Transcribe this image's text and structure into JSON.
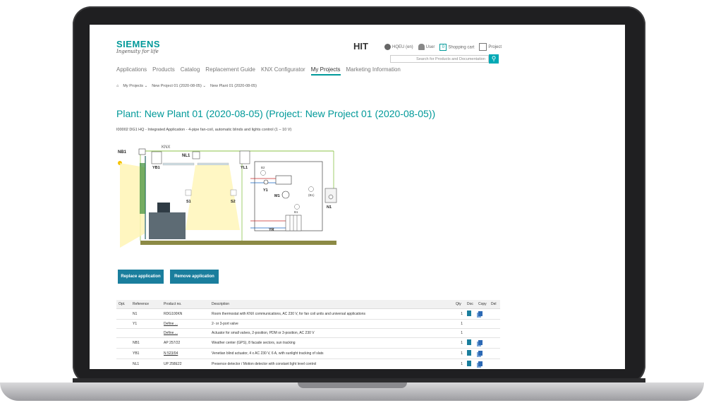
{
  "brand": {
    "name": "SIEMENS",
    "tagline": "Ingenuity for life",
    "app": "HIT"
  },
  "toplinks": {
    "region": "HQEU (en)",
    "user": "User",
    "cart_count": "0",
    "cart": "Shopping cart",
    "project": "Project"
  },
  "search": {
    "placeholder": "Search for Products and Documentation"
  },
  "nav": [
    "Applications",
    "Products",
    "Catalog",
    "Replacement Guide",
    "KNX Configurator",
    "My Projects",
    "Marketing Information"
  ],
  "nav_active": "My Projects",
  "breadcrumb": [
    "My Projects",
    "New Project 01 (2020-08-05)",
    "New Plant 01 (2020-08-05)"
  ],
  "page": {
    "title": "Plant: New Plant 01 (2020-08-05) (Project: New Project 01 (2020-08-05))",
    "subtitle": "I00002 DG1 HQ - Integrated Application - 4-pipe fan-coil, automatic blinds and lights control (1 – 10 V)"
  },
  "diagram": {
    "labels": {
      "knx": "KNX",
      "nb1": "NB1",
      "yb1": "YB1",
      "nl1": "NL1",
      "yl1": "YL1",
      "s1": "S1",
      "s2": "S2",
      "y1": "Y1",
      "m1": "M1",
      "n1": "N1",
      "yr": "YR",
      "b2": "B2",
      "b1": "B1",
      "b1b": "(B1)"
    }
  },
  "buttons": {
    "replace": "Replace application",
    "remove": "Remove application"
  },
  "table": {
    "headers": [
      "Opt.",
      "Reference",
      "Product no.",
      "Description",
      "Qty",
      "Doc",
      "Copy",
      "Del"
    ],
    "rows": [
      {
        "ref": "N1",
        "product": "RDG100KN",
        "desc": "Room thermostat with KNX communications, AC 230 V, for fan coil units and universal applications",
        "qty": "1",
        "doc": true,
        "copy": true
      },
      {
        "ref": "Y1",
        "product": "Define ...",
        "desc": "2- or 3-port valve",
        "qty": "1",
        "doc": false,
        "copy": false
      },
      {
        "ref": "",
        "product": "Define ...",
        "desc": "Actuator for small valves, 2-position, PDM or 3-position, AC 230 V",
        "qty": "1",
        "doc": false,
        "copy": false
      },
      {
        "ref": "NB1",
        "product": "AP 257/22",
        "desc": "Weather center (GPS), 8 facade sectors, sun tracking",
        "qty": "1",
        "doc": true,
        "copy": true
      },
      {
        "ref": "YB1",
        "product": "N 523/04",
        "desc": "Venetian blind actuator, 4 x AC 230 V, 6 A, with sunlight tracking of slats",
        "qty": "1",
        "doc": true,
        "copy": true
      },
      {
        "ref": "NL1",
        "product": "UP 258E22",
        "desc": "Presence detector / Motion detector with constant light level control",
        "qty": "1",
        "doc": true,
        "copy": true
      }
    ]
  },
  "colors": {
    "accent": "#009999",
    "button": "#1a7e9d"
  }
}
